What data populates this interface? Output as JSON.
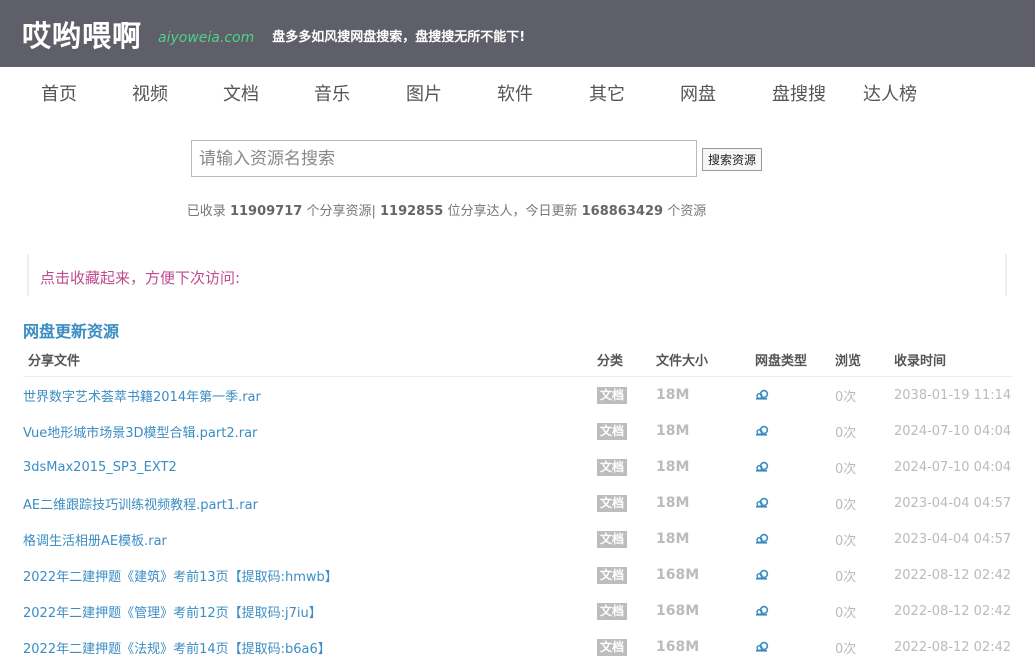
{
  "header": {
    "logo_text": "哎哟喂啊",
    "domain": "aiyoweia.com",
    "slogan": "盘多多如风搜网盘搜索，盘搜搜无所不能下!"
  },
  "nav": {
    "items": [
      "首页",
      "视频",
      "文档",
      "音乐",
      "图片",
      "软件",
      "其它",
      "网盘",
      "盘搜搜",
      "达人榜"
    ]
  },
  "search": {
    "placeholder": "请输入资源名搜索",
    "button_label": "搜索资源"
  },
  "stats": {
    "prefix": "已收录",
    "resources_count": "11909717",
    "resources_suffix": "个分享资源",
    "separator": "|",
    "users_count": "1192855",
    "users_suffix": "位分享达人，今日更新",
    "today_count": "168863429",
    "today_suffix": "个资源"
  },
  "bookmark": {
    "text": "点击收藏起来，方便下次访问:"
  },
  "section": {
    "title": "网盘更新资源"
  },
  "table": {
    "columns": [
      "分享文件",
      "分类",
      "文件大小",
      "网盘类型",
      "浏览",
      "收录时间"
    ],
    "rows": [
      {
        "name": "世界数字艺术荟萃书籍2014年第一季.rar",
        "category": "文档",
        "size": "18M",
        "views": "0次",
        "time": "2038-01-19 11:14"
      },
      {
        "name": "Vue地形城市场景3D模型合辑.part2.rar",
        "category": "文档",
        "size": "18M",
        "views": "0次",
        "time": "2024-07-10 04:04"
      },
      {
        "name": "3dsMax2015_SP3_EXT2",
        "category": "文档",
        "size": "18M",
        "views": "0次",
        "time": "2024-07-10 04:04"
      },
      {
        "name": "AE二维跟踪技巧训练视频教程.part1.rar",
        "category": "文档",
        "size": "18M",
        "views": "0次",
        "time": "2023-04-04 04:57"
      },
      {
        "name": "格调生活相册AE模板.rar",
        "category": "文档",
        "size": "18M",
        "views": "0次",
        "time": "2023-04-04 04:57"
      },
      {
        "name": "2022年二建押题《建筑》考前13页【提取码:hmwb】",
        "category": "文档",
        "size": "168M",
        "views": "0次",
        "time": "2022-08-12 02:42"
      },
      {
        "name": "2022年二建押题《管理》考前12页【提取码:j7iu】",
        "category": "文档",
        "size": "168M",
        "views": "0次",
        "time": "2022-08-12 02:42"
      },
      {
        "name": "2022年二建押题《法规》考前14页【提取码:b6a6】",
        "category": "文档",
        "size": "168M",
        "views": "0次",
        "time": "2022-08-12 02:42"
      }
    ],
    "netdisk_icon": "baidu-pan-icon"
  },
  "colors": {
    "header_bg": "#5f5f69",
    "domain": "#4fd18b",
    "link": "#3b8dc4",
    "bookmark_text": "#c04b8f",
    "badge_bg": "#bdbdbd"
  }
}
